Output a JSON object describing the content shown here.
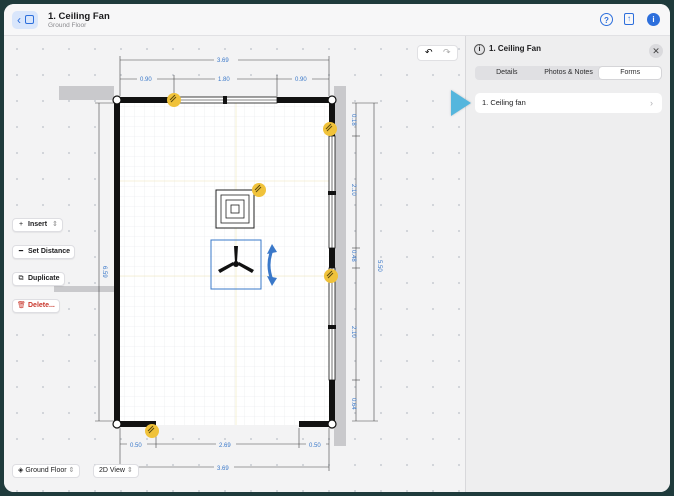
{
  "header": {
    "title": "1. Ceiling Fan",
    "subtitle": "Ground Floor",
    "icons": [
      "help-icon",
      "share-icon",
      "info-icon"
    ]
  },
  "toolbar": {
    "insert_label": "Insert",
    "set_distance_label": "Set Distance",
    "duplicate_label": "Duplicate",
    "delete_label": "Delete..."
  },
  "bottom": {
    "floor_label": "Ground Floor",
    "view_label": "2D View"
  },
  "panel": {
    "title": "1. Ceiling Fan",
    "tabs": [
      {
        "label": "Details",
        "active": false
      },
      {
        "label": "Photos & Notes",
        "active": false
      },
      {
        "label": "Forms",
        "active": true
      }
    ],
    "forms": [
      {
        "label": "1. Ceiling fan"
      }
    ]
  },
  "dimensions": {
    "top_total": "3.69",
    "top_left": "0.90",
    "top_mid": "1.80",
    "top_right": "0.90",
    "left_height": "6.59",
    "right_total": "5.50",
    "right_seg1": "0.18",
    "right_seg2": "2.10",
    "right_seg3": "0.48",
    "right_seg4": "2.10",
    "right_seg5": "0.64",
    "bottom_left": "0.50",
    "bottom_mid": "2.69",
    "bottom_right": "0.50",
    "bottom_total": "3.69"
  },
  "colors": {
    "accent": "#2d6fdc",
    "dimension": "#3a78c9",
    "attachment": "#f0c23a",
    "pointer": "#55b6dd",
    "delete": "#c8362b"
  }
}
